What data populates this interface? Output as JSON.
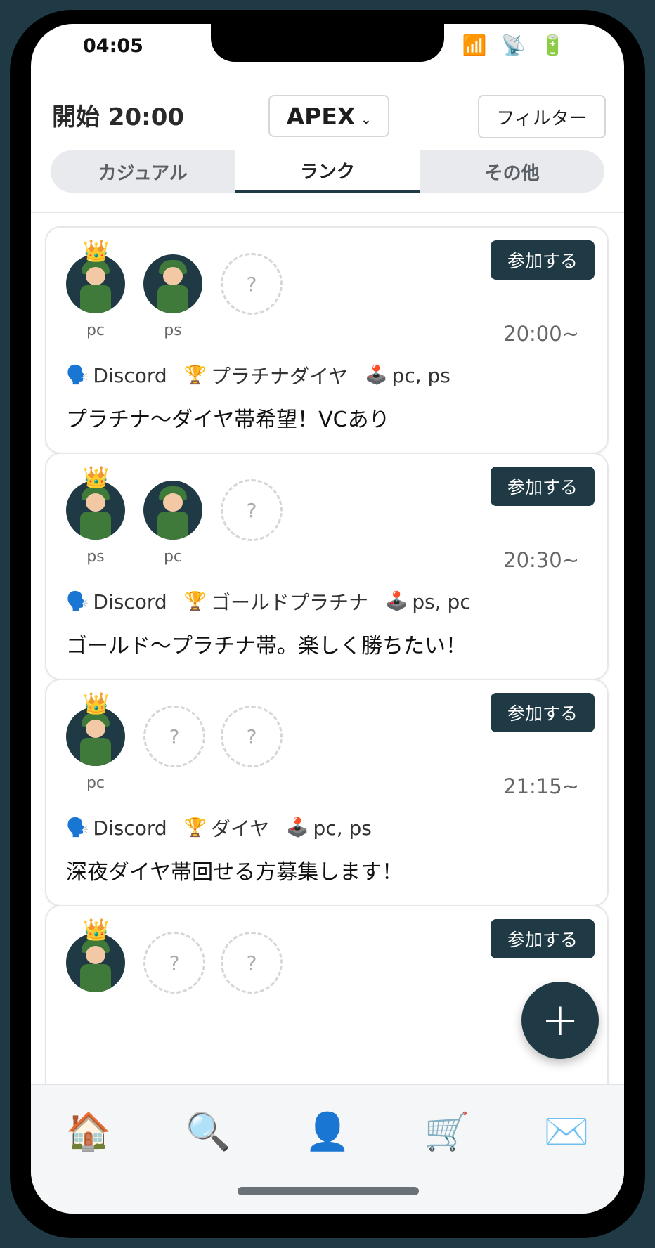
{
  "status": {
    "time": "04:05",
    "icons": "📶 📡 🔋"
  },
  "header": {
    "start_label": "開始 20:00",
    "game": "APEX",
    "game_chevron": "⌄",
    "filter_label": "フィルター"
  },
  "tabs": [
    {
      "label": "カジュアル",
      "active": false
    },
    {
      "label": "ランク",
      "active": true
    },
    {
      "label": "その他",
      "active": false
    }
  ],
  "join_label": "参加する",
  "empty_slot_label": "?",
  "icons": {
    "voice": "🗣️",
    "rank": "🏆",
    "platform": "🕹️",
    "crown": "👑"
  },
  "cards": [
    {
      "platforms": [
        "pc",
        "ps"
      ],
      "time": "20:00~",
      "voice": "Discord",
      "rank": "プラチナダイヤ",
      "platform_summary": "pc, ps",
      "comment": "プラチナ〜ダイヤ帯希望！VCあり"
    },
    {
      "platforms": [
        "ps",
        "pc"
      ],
      "time": "20:30~",
      "voice": "Discord",
      "rank": "ゴールドプラチナ",
      "platform_summary": "ps, pc",
      "comment": "ゴールド〜プラチナ帯。楽しく勝ちたい！"
    },
    {
      "platforms": [
        "pc"
      ],
      "time": "21:15~",
      "voice": "Discord",
      "rank": "ダイヤ",
      "platform_summary": "pc, ps",
      "comment": "深夜ダイヤ帯回せる方募集します！"
    },
    {
      "platforms": [
        ""
      ],
      "time": "",
      "voice": "",
      "rank": "",
      "platform_summary": "",
      "comment": ""
    }
  ],
  "fab_label": "+",
  "nav": [
    {
      "name": "home",
      "icon": "🏠"
    },
    {
      "name": "search",
      "icon": "🔍"
    },
    {
      "name": "profile",
      "icon": "👤"
    },
    {
      "name": "shop",
      "icon": "🛒"
    },
    {
      "name": "mail",
      "icon": "✉️"
    }
  ],
  "colors": {
    "accent": "#1f3a44",
    "tab_bg": "#e8eaee"
  }
}
